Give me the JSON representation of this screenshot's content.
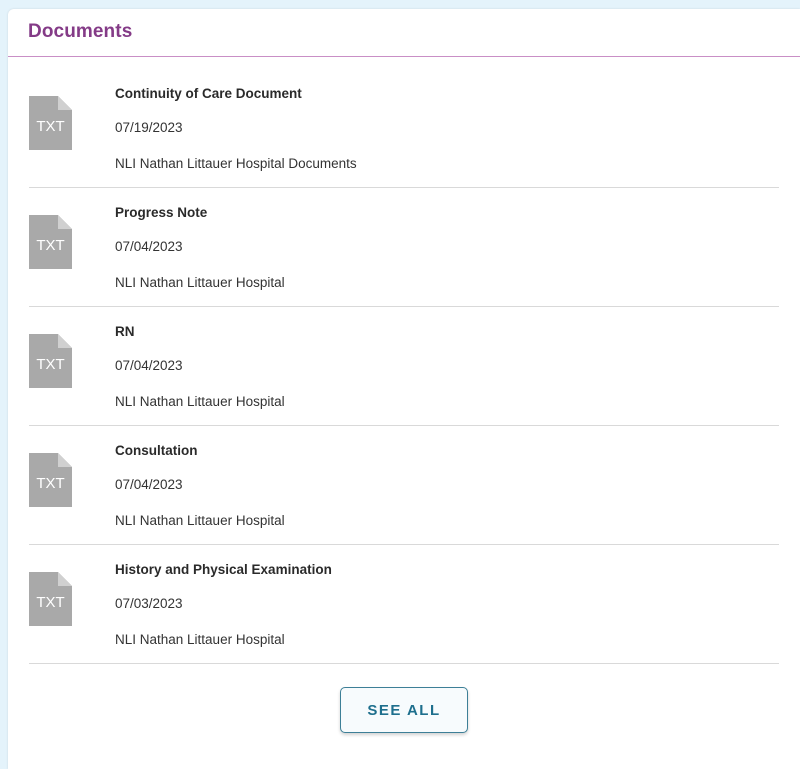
{
  "panel": {
    "title": "Documents",
    "title_color": "#843b87",
    "accent_line_color": "#c98fc6"
  },
  "file_icon": {
    "name": "txt-file-icon",
    "label": "TXT",
    "color": "#a9a9a9"
  },
  "documents": [
    {
      "title": "Continuity of Care Document",
      "date": "07/19/2023",
      "source": "NLI Nathan Littauer Hospital Documents"
    },
    {
      "title": "Progress Note",
      "date": "07/04/2023",
      "source": "NLI Nathan Littauer Hospital"
    },
    {
      "title": "RN",
      "date": "07/04/2023",
      "source": "NLI Nathan Littauer Hospital"
    },
    {
      "title": "Consultation",
      "date": "07/04/2023",
      "source": "NLI Nathan Littauer Hospital"
    },
    {
      "title": "History and Physical Examination",
      "date": "07/03/2023",
      "source": "NLI Nathan Littauer Hospital"
    }
  ],
  "actions": {
    "see_all_label": "SEE ALL",
    "button_color": "#1e6f8d"
  }
}
